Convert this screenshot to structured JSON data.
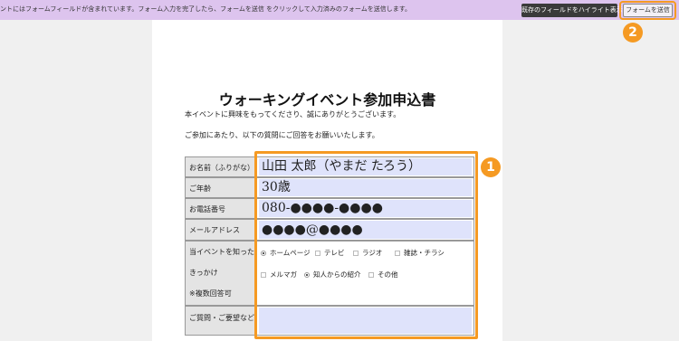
{
  "toolbar": {
    "message": "ントにはフォームフィールドが含まれています。フォーム入力を完了したら、フォームを送信 をクリックして入力済みのフォームを送信します。",
    "highlight_button": "既存のフィールドをハイライト表示",
    "submit_button": "フォームを送信"
  },
  "badges": {
    "one": "1",
    "two": "2"
  },
  "document": {
    "title": "ウォーキングイベント参加申込書",
    "intro1": "本イベントに興味をもってくださり、誠にありがとうございます。",
    "intro2": "ご参加にあたり、以下の質問にご回答をお願いいたします。",
    "labels": {
      "name": "お名前（ふりがな）",
      "age": "ご年齢",
      "phone": "お電話番号",
      "email": "メールアドレス",
      "how_line1": "当イベントを知った",
      "how_line2": "きっかけ",
      "how_line3": "※複数回答可",
      "requests": "ご質問・ご要望など"
    },
    "values": {
      "name": "山田 太郎（やまだ たろう）",
      "age": "30歳",
      "phone": "080-●●●●-●●●●",
      "email": "●●●●@●●●●",
      "requests": ""
    },
    "options": [
      {
        "label": "ホームページ",
        "type": "radio",
        "selected": true
      },
      {
        "label": "テレビ",
        "type": "check",
        "selected": false
      },
      {
        "label": "ラジオ",
        "type": "check",
        "selected": false
      },
      {
        "label": "雑誌・チラシ",
        "type": "check",
        "selected": false
      },
      {
        "label": "メルマガ",
        "type": "check",
        "selected": false
      },
      {
        "label": "知人からの紹介",
        "type": "radio",
        "selected": true
      },
      {
        "label": "その他",
        "type": "check",
        "selected": false
      }
    ]
  },
  "colors": {
    "accent": "#f59a23",
    "toolbar_bg": "#ddc4ee",
    "field_bg": "#dfe3fb"
  }
}
